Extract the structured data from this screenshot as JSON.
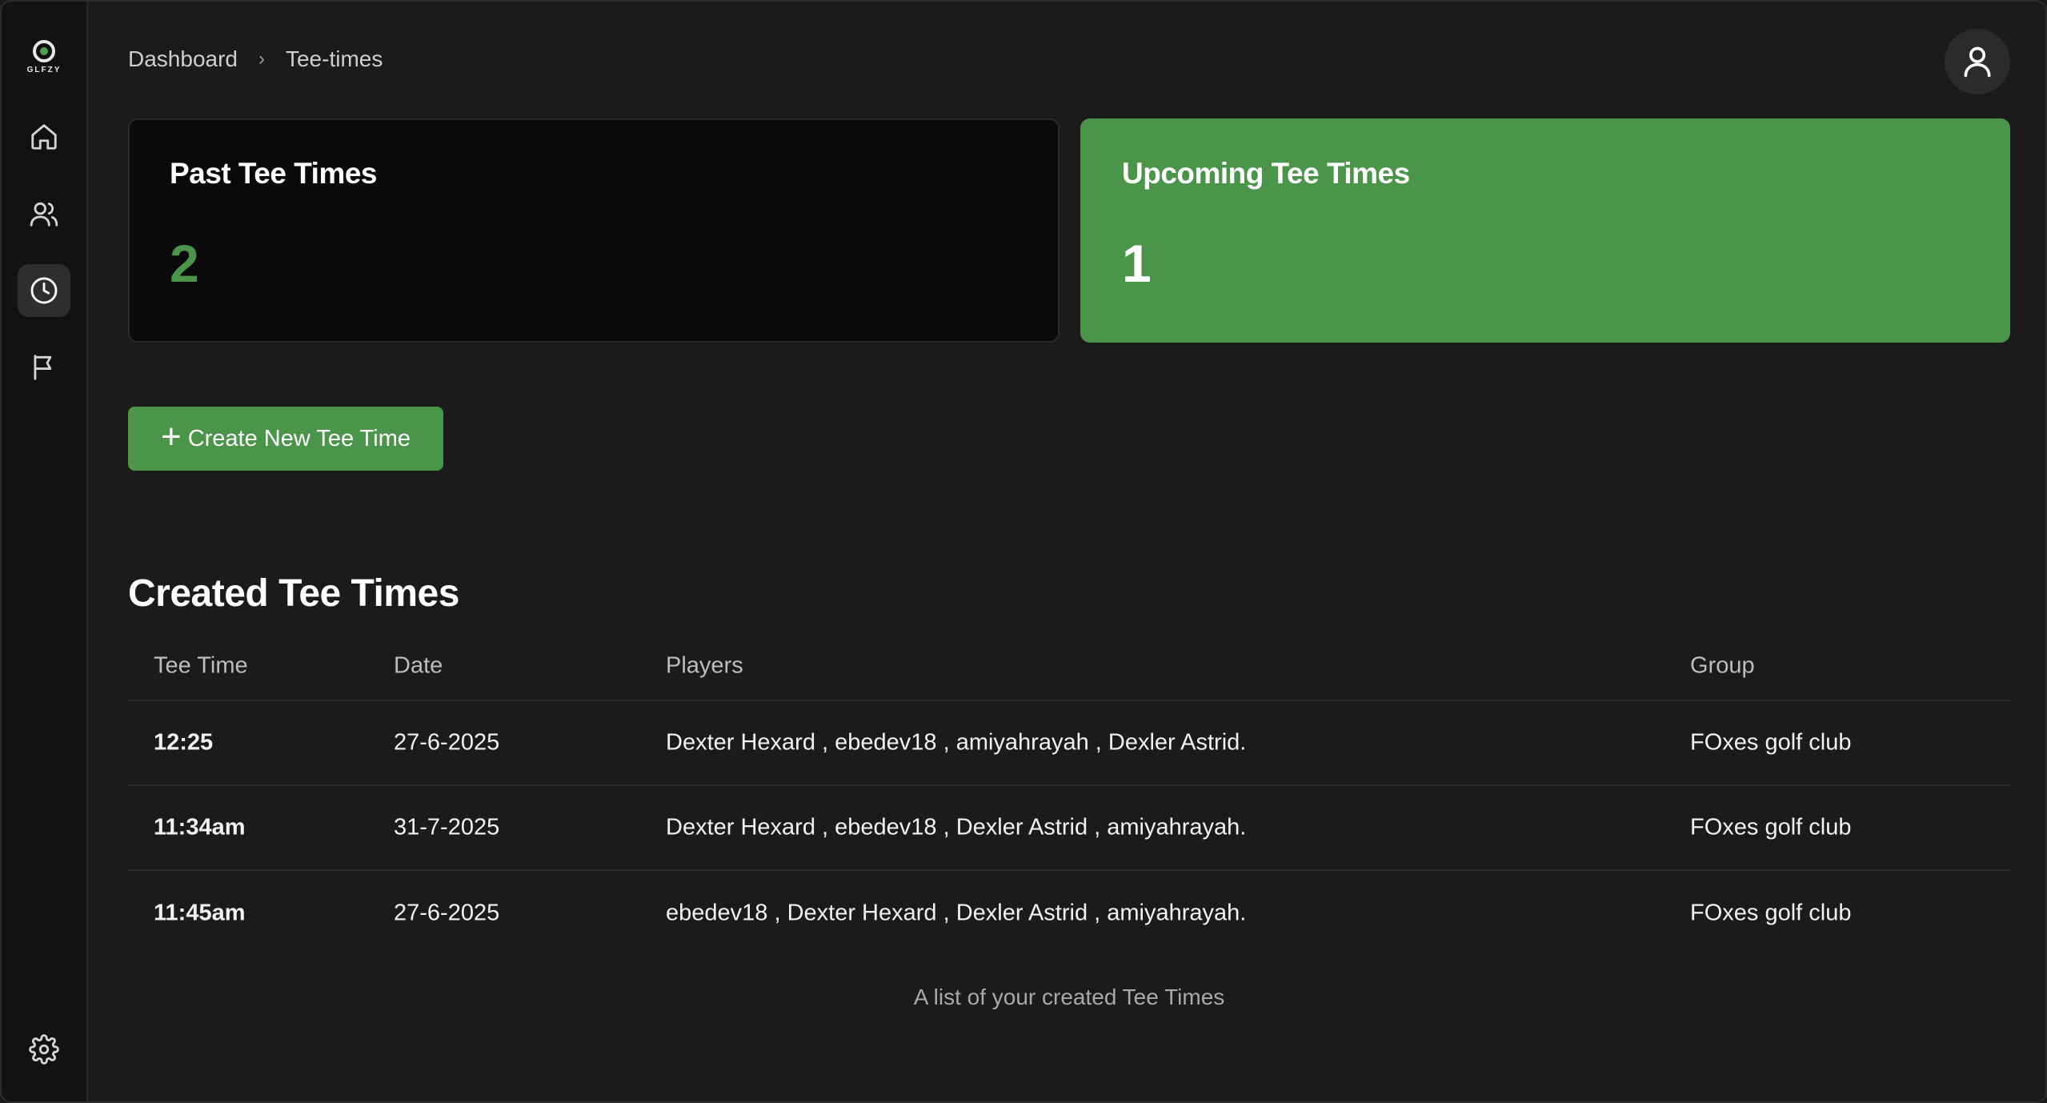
{
  "app": {
    "logo_text": "GLFZY"
  },
  "sidebar": {
    "items": [
      {
        "icon": "home-icon",
        "label": "Home"
      },
      {
        "icon": "users-icon",
        "label": "Players"
      },
      {
        "icon": "clock-icon",
        "label": "Tee-times"
      },
      {
        "icon": "flag-icon",
        "label": "Courses"
      }
    ],
    "active_index": 2,
    "settings_icon": "gear-icon"
  },
  "header": {
    "breadcrumb": [
      "Dashboard",
      "Tee-times"
    ],
    "breadcrumb_separator": "›",
    "avatar_icon": "user-icon"
  },
  "stats": {
    "past": {
      "title": "Past Tee Times",
      "value": "2"
    },
    "upcoming": {
      "title": "Upcoming Tee Times",
      "value": "1"
    }
  },
  "actions": {
    "create_label": "Create New Tee Time",
    "create_icon": "plus-icon"
  },
  "table": {
    "title": "Created Tee Times",
    "columns": [
      "Tee Time",
      "Date",
      "Players",
      "Group"
    ],
    "rows": [
      {
        "time": "12:25",
        "date": "27-6-2025",
        "players": "Dexter Hexard , ebedev18 , amiyahrayah , Dexler Astrid.",
        "group": "FOxes golf club"
      },
      {
        "time": "11:34am",
        "date": "31-7-2025",
        "players": "Dexter Hexard , ebedev18 , Dexler Astrid , amiyahrayah.",
        "group": "FOxes golf club"
      },
      {
        "time": "11:45am",
        "date": "27-6-2025",
        "players": "ebedev18 , Dexter Hexard , Dexler Astrid , amiyahrayah.",
        "group": "FOxes golf club"
      }
    ],
    "caption": "A list of your created Tee Times"
  },
  "colors": {
    "accent": "#4b954a",
    "background": "#1b1b1b",
    "sidebar": "#121212"
  }
}
